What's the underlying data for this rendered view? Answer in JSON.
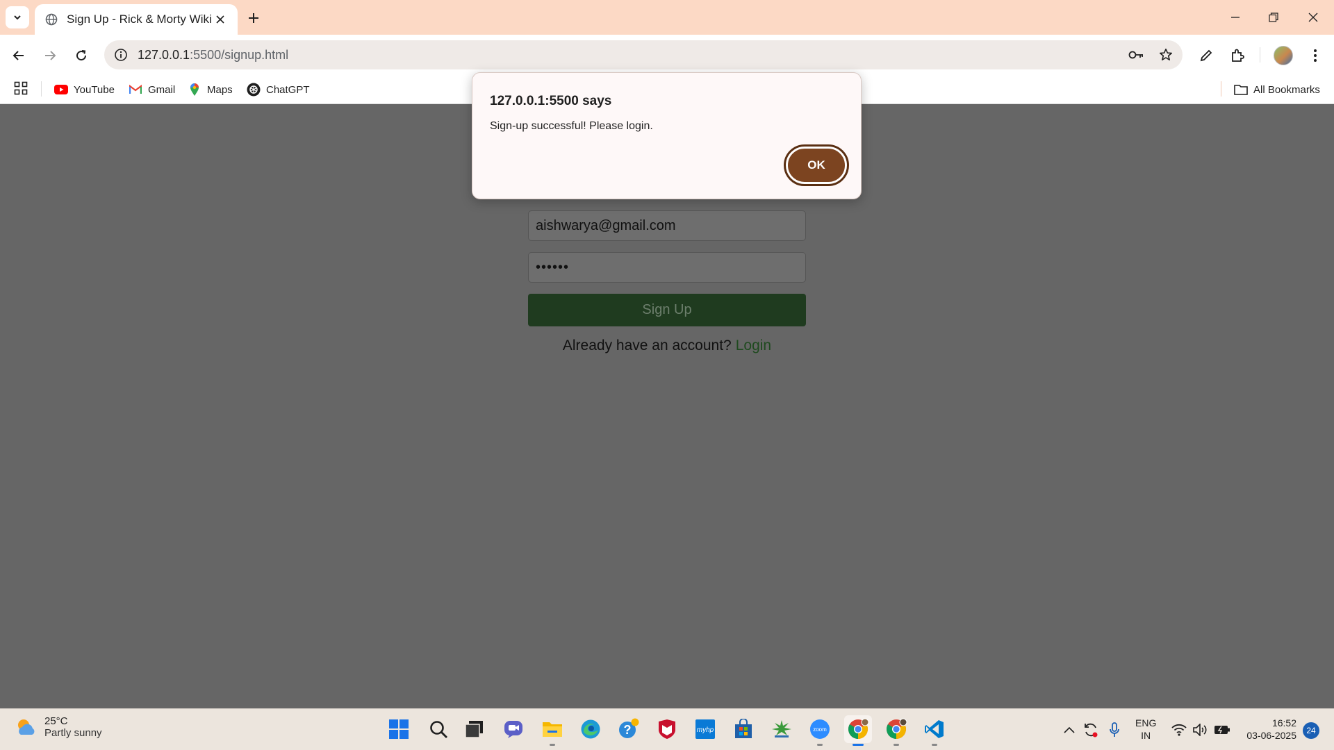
{
  "browser": {
    "tab_title": "Sign Up - Rick & Morty Wiki",
    "url_host": "127.0.0.1",
    "url_rest": ":5500/signup.html"
  },
  "bookmarks": [
    {
      "label": "YouTube",
      "icon": "youtube-icon"
    },
    {
      "label": "Gmail",
      "icon": "gmail-icon"
    },
    {
      "label": "Maps",
      "icon": "maps-icon"
    },
    {
      "label": "ChatGPT",
      "icon": "chatgpt-icon"
    }
  ],
  "all_bookmarks_label": "All Bookmarks",
  "form": {
    "email_value": "aishwarya@gmail.com",
    "password_value": "••••••",
    "signup_label": "Sign Up",
    "already_text": "Already have an account?",
    "login_link": "Login"
  },
  "dialog": {
    "title": "127.0.0.1:5500 says",
    "message": "Sign-up successful! Please login.",
    "ok_label": "OK"
  },
  "taskbar": {
    "weather_temp": "25°C",
    "weather_desc": "Partly sunny",
    "lang_line1": "ENG",
    "lang_line2": "IN",
    "time": "16:52",
    "date": "03-06-2025",
    "notifications": "24"
  },
  "colors": {
    "titlebar": "#fcd9c5",
    "page_overlay": "#666666",
    "signup_button": "#1f3b1f",
    "dialog_ok": "#7c4420"
  }
}
